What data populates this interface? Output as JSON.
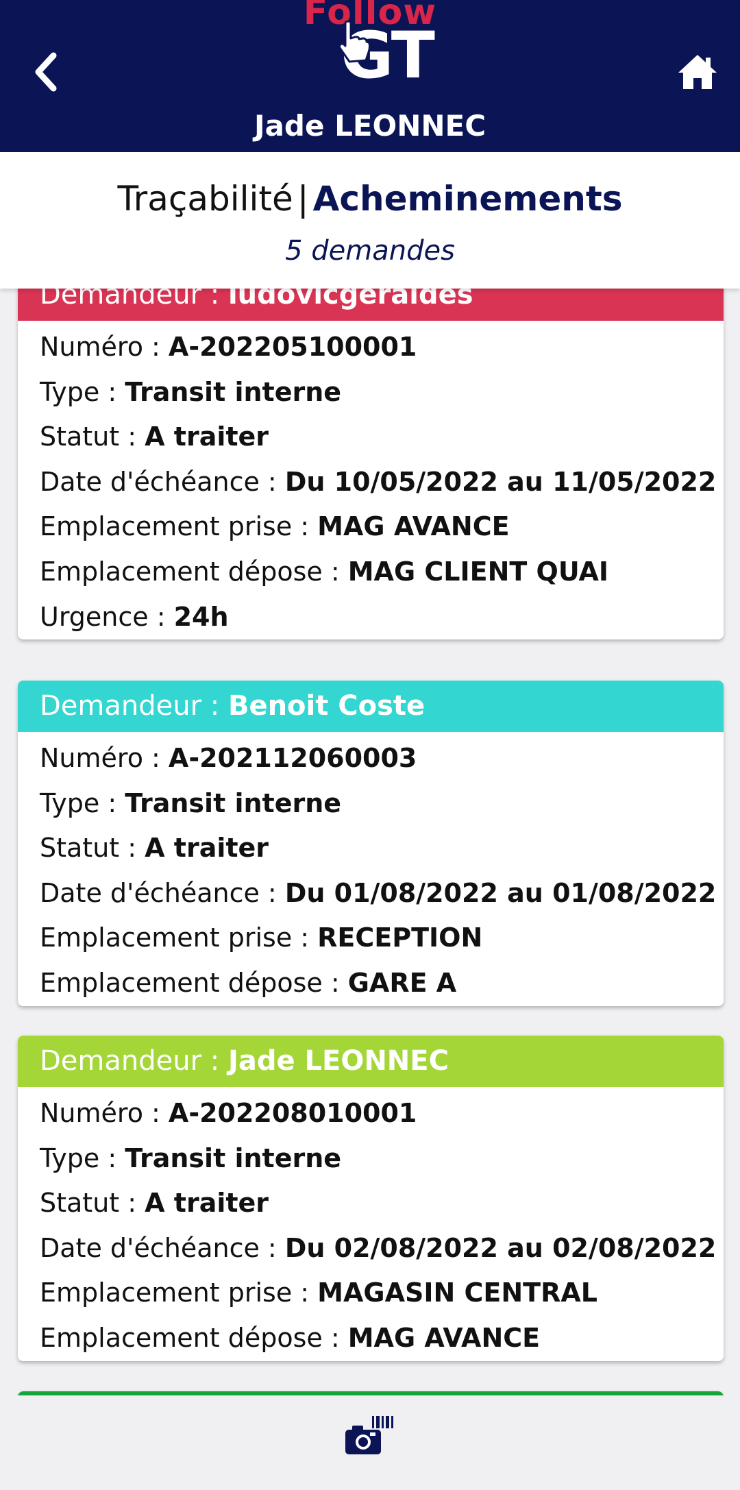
{
  "header": {
    "logo_top": "Follow",
    "logo_bottom": "GT",
    "user_name": "Jade LEONNEC"
  },
  "subheader": {
    "tab_tracabilite": "Traçabilité",
    "separator": "|",
    "tab_acheminements": "Acheminements",
    "count": "5 demandes"
  },
  "labels": {
    "demandeur": "Demandeur : ",
    "numero": "Numéro : ",
    "type": "Type : ",
    "statut": "Statut : ",
    "date": "Date d'échéance : ",
    "prise": "Emplacement prise : ",
    "depose": "Emplacement dépose : ",
    "urgence": "Urgence : "
  },
  "cards": [
    {
      "color": "#d93454",
      "demandeur": "ludovicgeraldes",
      "numero": "A-202205100001",
      "type": "Transit interne",
      "statut": "A traiter",
      "date": "Du 10/05/2022 au 11/05/2022",
      "prise": "MAG AVANCE",
      "depose": "MAG CLIENT QUAI",
      "urgence": "24h"
    },
    {
      "color": "#33d6d0",
      "demandeur": "Benoit Coste",
      "numero": "A-202112060003",
      "type": "Transit interne",
      "statut": "A traiter",
      "date": "Du 01/08/2022 au 01/08/2022",
      "prise": "RECEPTION",
      "depose": "GARE A"
    },
    {
      "color": "#a4d637",
      "demandeur": "Jade LEONNEC",
      "numero": "A-202208010001",
      "type": "Transit interne",
      "statut": "A traiter",
      "date": "Du 02/08/2022 au 02/08/2022",
      "prise": "MAGASIN CENTRAL",
      "depose": "MAG AVANCE"
    },
    {
      "color": "#17a43a"
    }
  ],
  "icons": {
    "back": "chevron-left-icon",
    "home": "home-icon",
    "scan": "camera-barcode-icon",
    "logo_pointer": "pointer-hand-icon"
  }
}
